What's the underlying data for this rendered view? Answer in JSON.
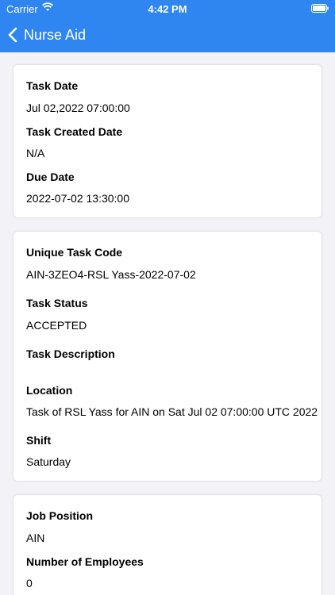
{
  "status_bar": {
    "carrier": "Carrier",
    "time": "4:42 PM"
  },
  "nav": {
    "back_label": "Nurse Aid"
  },
  "cards": [
    {
      "fields": [
        {
          "label": "Task Date",
          "value": "Jul 02,2022 07:00:00"
        },
        {
          "label": "Task Created Date",
          "value": "N/A"
        },
        {
          "label": "Due Date",
          "value": "2022-07-02 13:30:00"
        }
      ]
    },
    {
      "fields": [
        {
          "label": "Unique Task Code",
          "value": "AIN-3ZEO4-RSL Yass-2022-07-02"
        },
        {
          "label": "Task Status",
          "value": "ACCEPTED"
        },
        {
          "label": "Task Description",
          "value": ""
        },
        {
          "label": "Location",
          "value": "Task of RSL Yass for AIN on Sat Jul 02 07:00:00 UTC 2022"
        },
        {
          "label": "Shift",
          "value": "Saturday"
        }
      ]
    },
    {
      "fields": [
        {
          "label": "Job Position",
          "value": "AIN"
        },
        {
          "label": "Number of Employees",
          "value": "0"
        }
      ]
    }
  ],
  "colors": {
    "header": "#2f86f0",
    "background": "#f2f2f7",
    "card": "#ffffff"
  }
}
